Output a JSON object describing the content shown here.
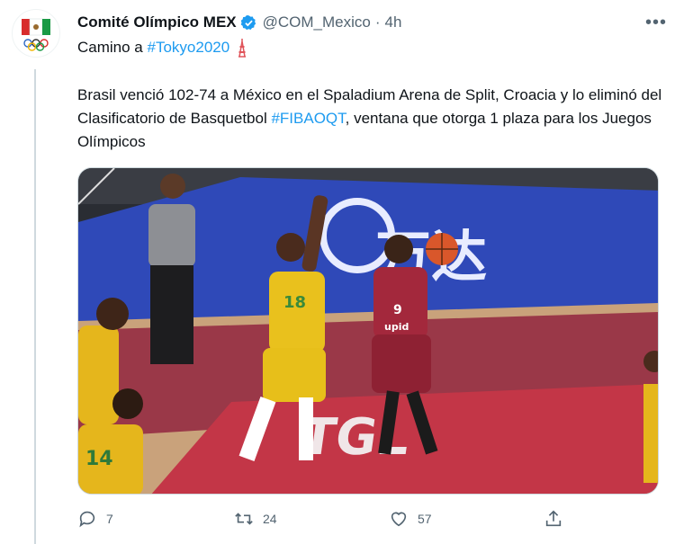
{
  "tweet": {
    "author_name": "Comité Olímpico MEX",
    "handle": "@COM_Mexico",
    "separator": "·",
    "time": "4h",
    "more_label": "•••",
    "line1_prefix": "Camino a",
    "line1_hashtag": "#Tokyo2020",
    "text_before_hashtag": "Brasil venció 102-74 a México en el Spaladium Arena de Split, Croacia y lo eliminó del Clasificatorio de Basquetbol ",
    "text_hashtag": "#FIBAOQT",
    "text_after_hashtag": ", ventana que otorga 1 plaza para los Juegos Olímpicos"
  },
  "media": {
    "banner_text": "万达",
    "court_text": "TGL",
    "jersey_brazil": "18",
    "jersey_brazil_2": "14",
    "jersey_mexico": "9",
    "jersey_sponsor": "upid"
  },
  "actions": {
    "replies": "7",
    "retweets": "24",
    "likes": "57"
  },
  "icons": {
    "verified": "verified-badge-icon",
    "reply": "reply-icon",
    "retweet": "retweet-icon",
    "like": "heart-icon",
    "share": "share-icon"
  },
  "colors": {
    "link": "#1d9bf0",
    "secondary": "#536471",
    "court": "#c33647",
    "banner": "#2f49b8"
  }
}
